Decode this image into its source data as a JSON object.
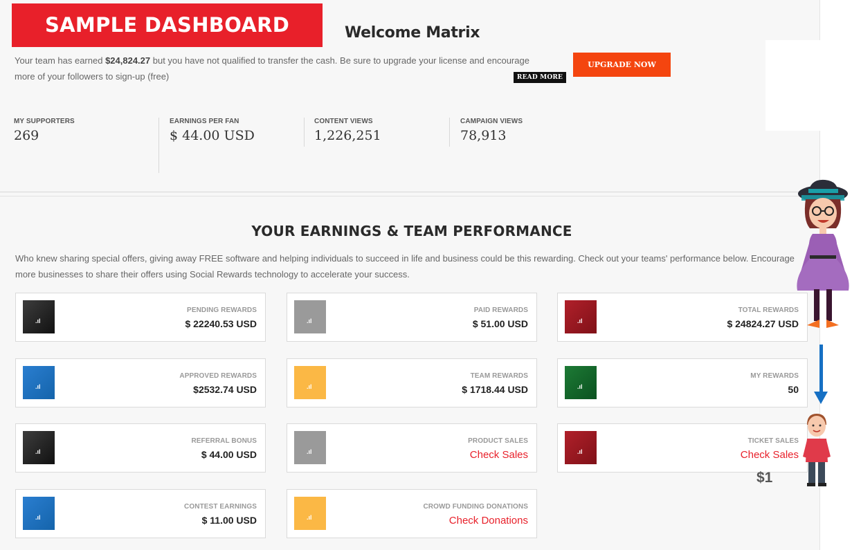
{
  "header": {
    "banner": "SAMPLE DASHBOARD",
    "welcome": "Welcome Matrix",
    "intro_prefix": "Your team has earned ",
    "intro_amount": "$24,824.27",
    "intro_suffix": " but you have not qualified to transfer the cash. Be sure to upgrade your license and encourage more of your followers to sign-up (free)",
    "read_more": "READ MORE",
    "upgrade_button": "UPGRADE NOW"
  },
  "stats": [
    {
      "label": "MY SUPPORTERS",
      "value": "269"
    },
    {
      "label": "EARNINGS PER FAN",
      "value": "$ 44.00 USD"
    },
    {
      "label": "CONTENT VIEWS",
      "value": "1,226,251"
    },
    {
      "label": "CAMPAIGN VIEWS",
      "value": "78,913"
    }
  ],
  "section": {
    "title": "YOUR EARNINGS & TEAM PERFORMANCE",
    "description": "Who knew sharing special offers, giving away FREE software and helping individuals to succeed in life and business could be this rewarding. Check out your teams' performance below. Encourage more businesses to share their offers using Social Rewards technology to accelerate your success."
  },
  "cards": [
    {
      "label": "PENDING REWARDS",
      "value": "$ 22240.53 USD",
      "color": "#2b2b2b",
      "icon": "bar-chart-icon"
    },
    {
      "label": "PAID REWARDS",
      "value": "$ 51.00 USD",
      "color": "#9a9a9a",
      "icon": "bar-chart-icon"
    },
    {
      "label": "TOTAL REWARDS",
      "value": "$ 24824.27 USD",
      "color": "#9a1b22",
      "icon": "bar-chart-icon"
    },
    {
      "label": "APPROVED REWARDS",
      "value": "$2532.74 USD",
      "color": "#1e72c0",
      "icon": "bar-chart-icon"
    },
    {
      "label": "TEAM REWARDS",
      "value": "$ 1718.44 USD",
      "color": "#fbb845",
      "icon": "bar-chart-icon"
    },
    {
      "label": "MY REWARDS",
      "value": "50",
      "color": "#136328",
      "icon": "bar-chart-icon"
    },
    {
      "label": "REFERRAL BONUS",
      "value": "$ 44.00 USD",
      "color": "#2b2b2b",
      "icon": "bar-chart-icon"
    },
    {
      "label": "PRODUCT SALES",
      "value": "Check Sales",
      "color": "#9a9a9a",
      "icon": "bar-chart-icon"
    },
    {
      "label": "TICKET SALES",
      "value": "Check Sales",
      "color": "#9a1b22",
      "icon": "bar-chart-icon"
    },
    {
      "label": "CONTEST EARNINGS",
      "value": "$ 11.00 USD",
      "color": "#1e72c0",
      "icon": "bar-chart-icon"
    },
    {
      "label": "CROWD FUNDING DONATIONS",
      "value": "Check Donations",
      "color": "#fbb845",
      "icon": "bar-chart-icon"
    }
  ],
  "illustration": {
    "amount": "$1",
    "arrow_color": "#1670c4"
  },
  "colors": {
    "accent_red": "#e8202a",
    "upgrade_orange": "#f4450f"
  }
}
